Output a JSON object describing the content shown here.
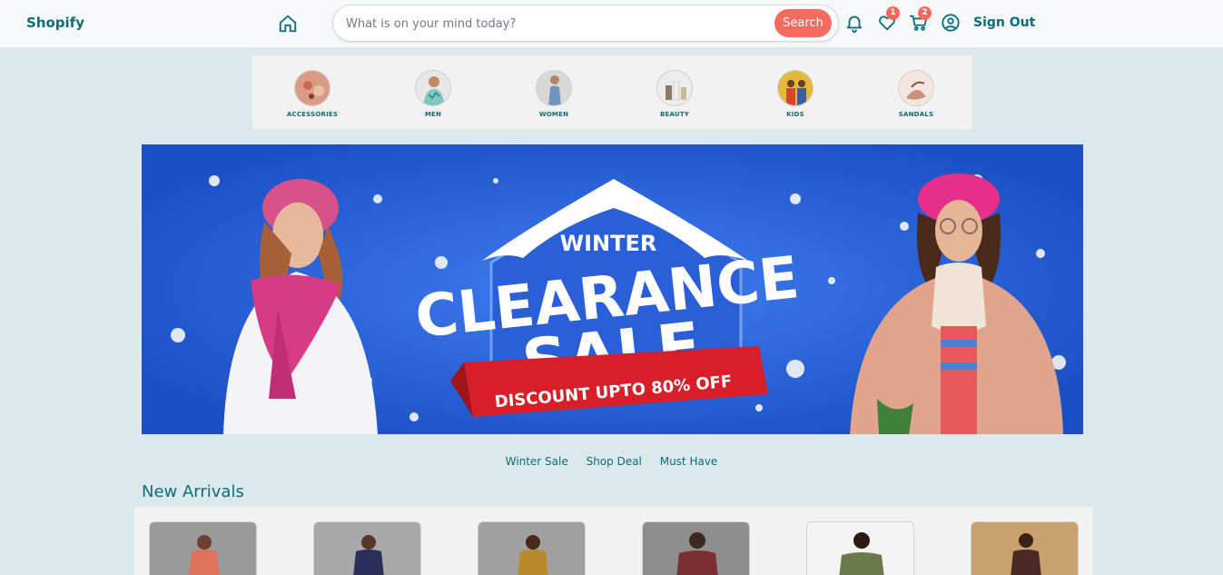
{
  "header": {
    "brand": "Shopify",
    "search_placeholder": "What is on your mind today?",
    "search_button": "Search",
    "wishlist_count": "1",
    "cart_count": "2",
    "sign_out": "Sign Out"
  },
  "categories": [
    {
      "label": "ACCESSORIES"
    },
    {
      "label": "MEN"
    },
    {
      "label": "WOMEN"
    },
    {
      "label": "BEAUTY"
    },
    {
      "label": "KIDS"
    },
    {
      "label": "SANDALS"
    }
  ],
  "banner": {
    "line1": "WINTER",
    "line2": "CLEARANCE",
    "line3": "SALE",
    "ribbon": "DISCOUNT UPTO 80% OFF"
  },
  "promo_links": [
    "Winter Sale",
    "Shop Deal",
    "Must Have"
  ],
  "new_arrivals": {
    "title": "New Arrivals"
  },
  "colors": {
    "brand": "#0b6e78",
    "accent": "#f56b5f",
    "background": "#dbe8ec"
  }
}
